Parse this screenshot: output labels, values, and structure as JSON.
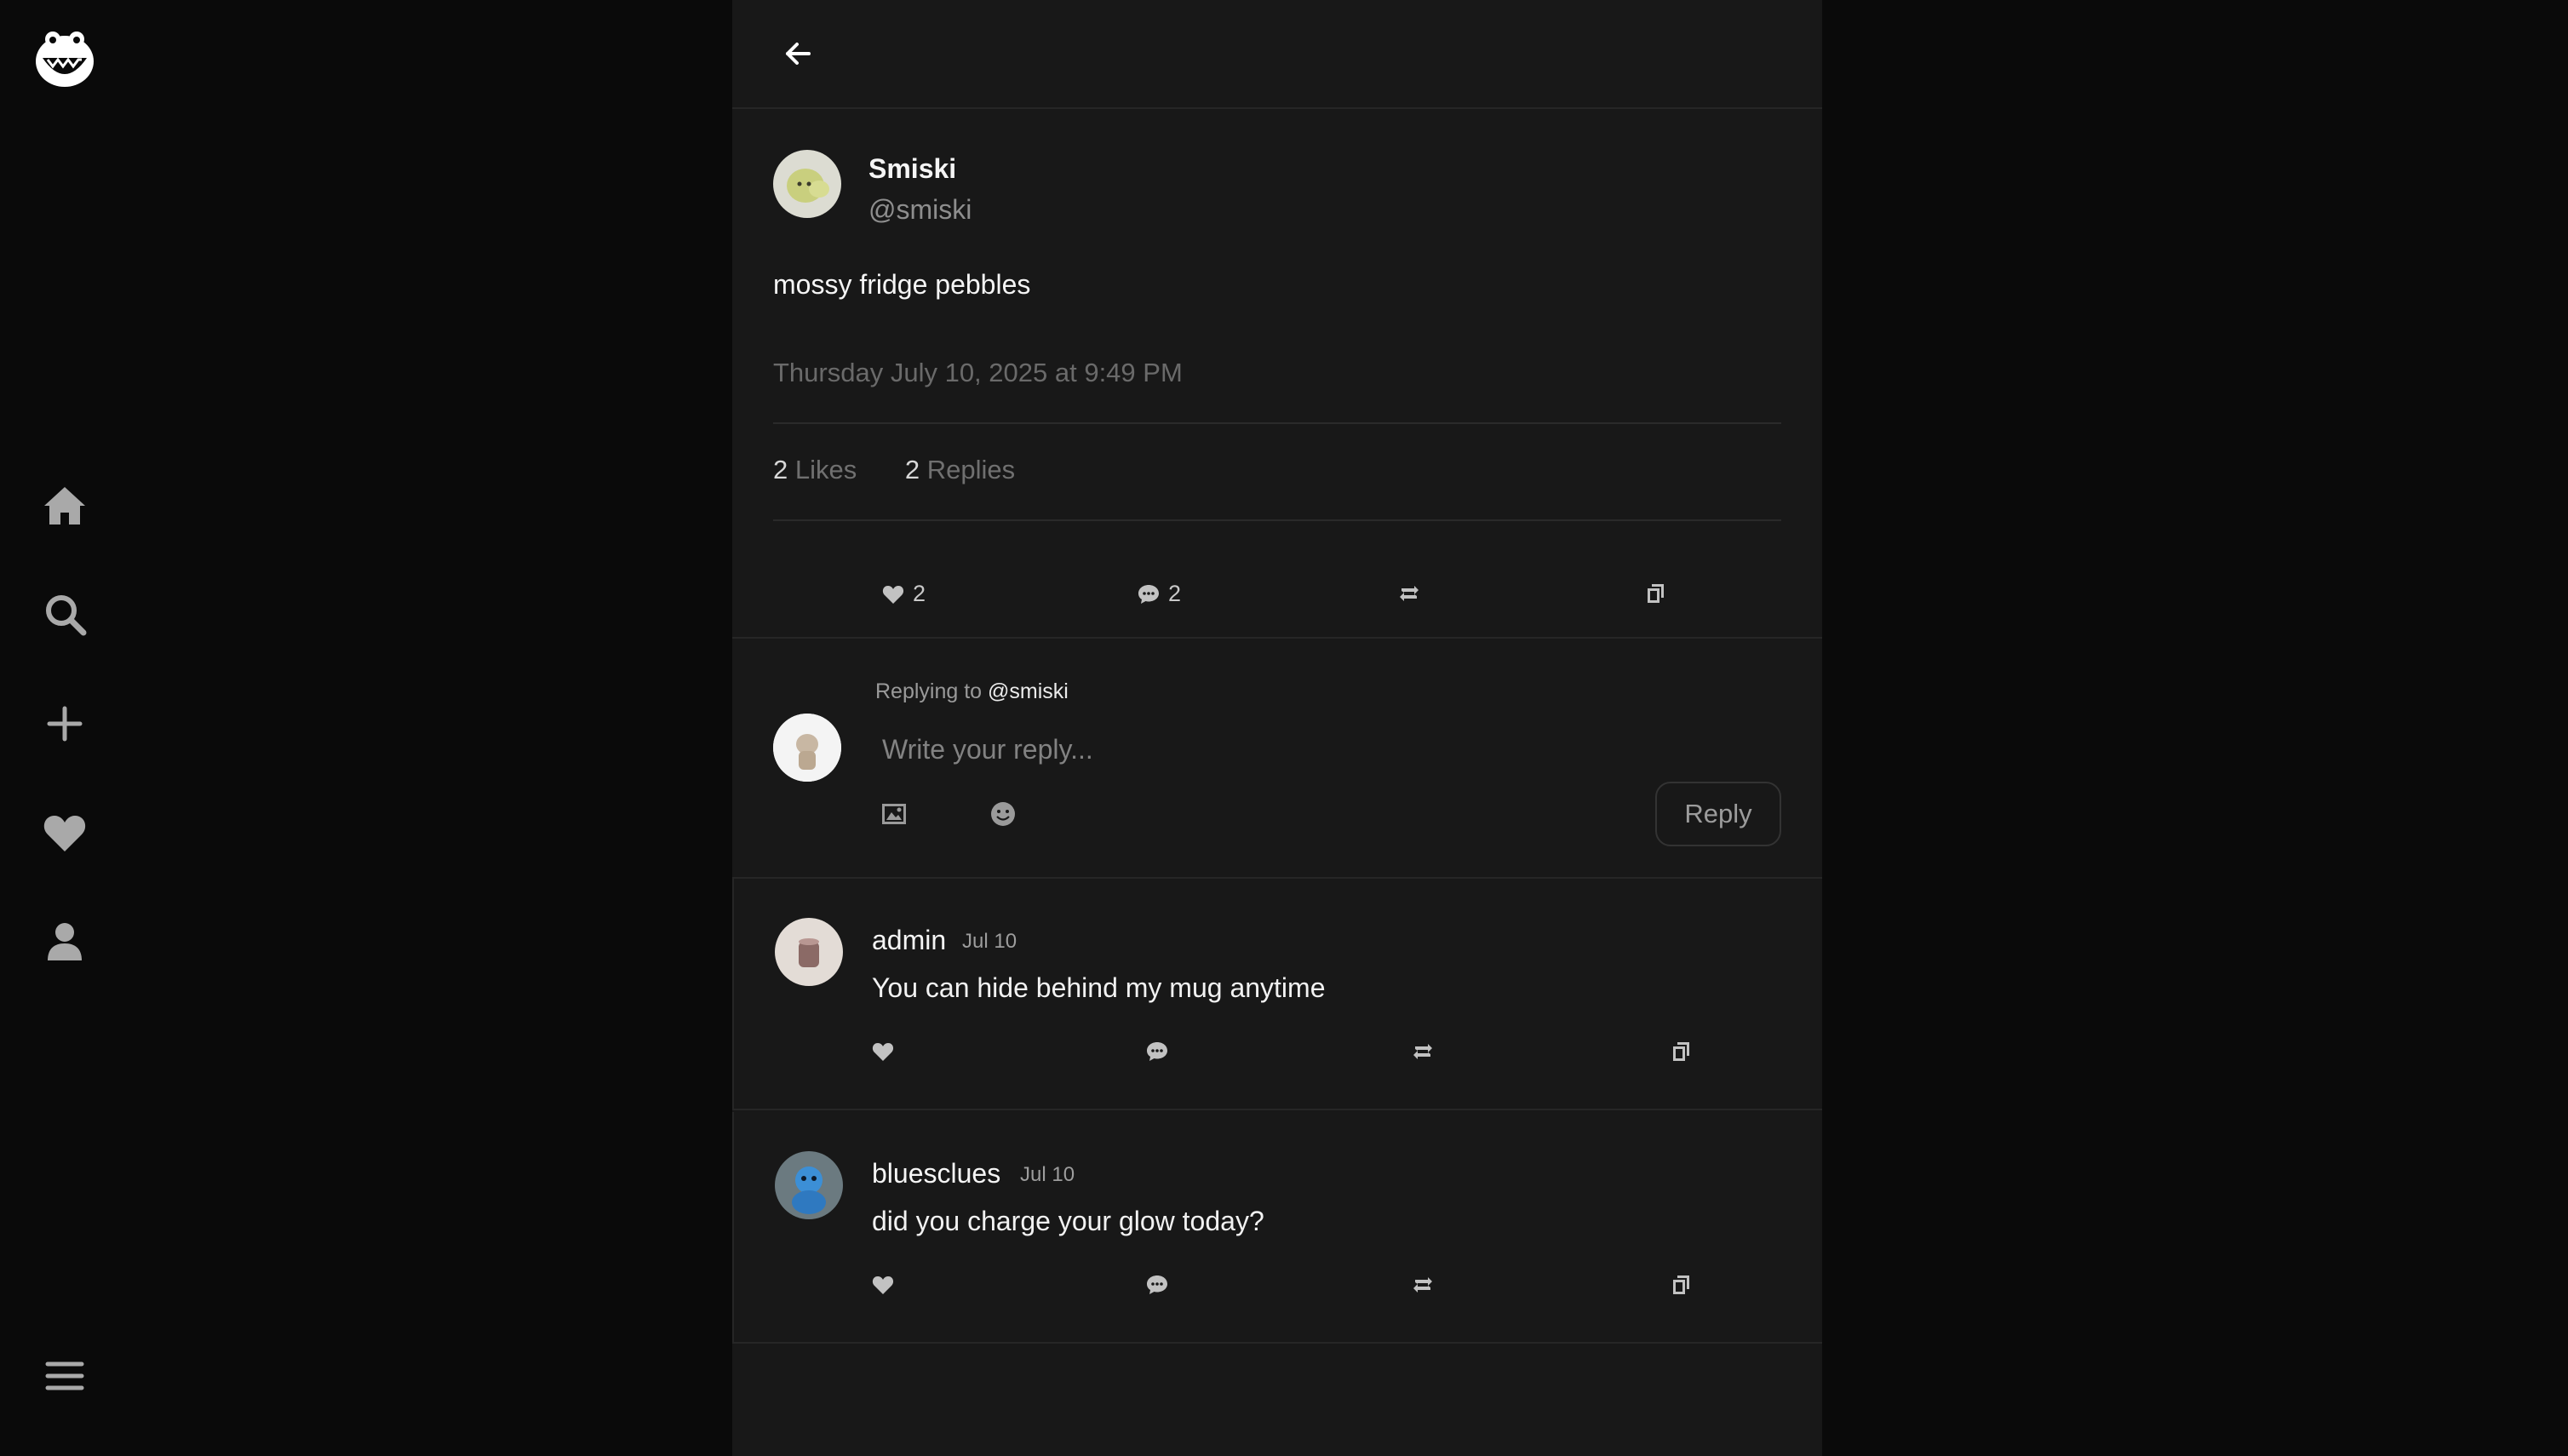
{
  "nav": {
    "logo_icon": "smiling-creature-logo",
    "items": [
      {
        "id": "home",
        "icon": "home-icon",
        "label": "Home"
      },
      {
        "id": "search",
        "icon": "search-icon",
        "label": "Search"
      },
      {
        "id": "create",
        "icon": "plus-icon",
        "label": "Create"
      },
      {
        "id": "activity",
        "icon": "heart-icon",
        "label": "Activity"
      },
      {
        "id": "profile",
        "icon": "person-icon",
        "label": "Profile"
      }
    ],
    "menu_icon": "hamburger-menu-icon"
  },
  "header": {
    "back_icon": "arrow-left-icon"
  },
  "post": {
    "author_name": "Smiski",
    "author_handle": "@smiski",
    "text": "mossy fridge pebbles",
    "timestamp": "Thursday July 10, 2025 at 9:49 PM",
    "likes_count": "2",
    "likes_label": "Likes",
    "replies_count": "2",
    "replies_label": "Replies",
    "actions": {
      "like_count": "2",
      "reply_count": "2"
    }
  },
  "composer": {
    "replying_prefix": "Replying to",
    "replying_handle": "@smiski",
    "placeholder": "Write your reply...",
    "reply_button": "Reply"
  },
  "replies": [
    {
      "name": "admin",
      "date": "Jul 10",
      "text": "You can hide behind my mug anytime"
    },
    {
      "name": "bluesclues",
      "date": "Jul 10",
      "text": "did you charge your glow today?"
    }
  ],
  "colors": {
    "page_bg": "#0a0a0a",
    "column_bg": "#181818",
    "divider": "#262626",
    "muted_text": "#6a6a6a"
  }
}
